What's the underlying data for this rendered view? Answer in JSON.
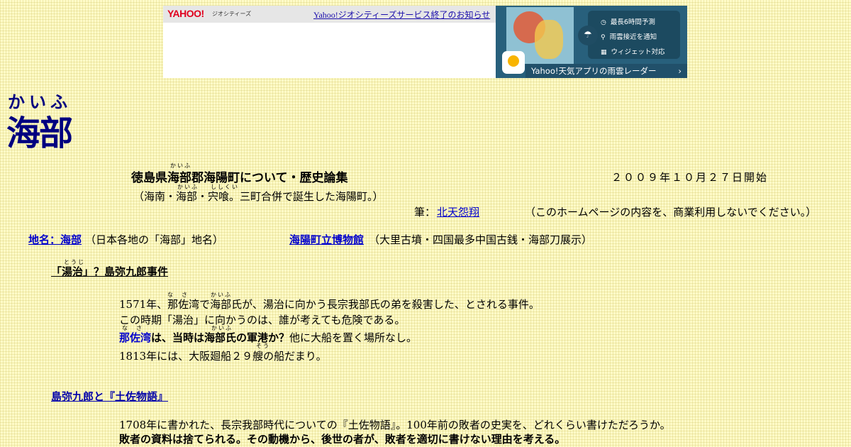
{
  "banner": {
    "logo": "YAHOO!",
    "logo_sub": "ジオシティーズ",
    "notice_link": "Yahoo!ジオシティーズサービス終了のお知らせ"
  },
  "ad": {
    "features": [
      "最長6時間予測",
      "雨雲接近を通知",
      "ウィジェット対応"
    ],
    "bottom": "Yahoo!天気アプリの雨雲レーダー",
    "bottom_arrow": "›",
    "feature_icons": [
      "clock-icon",
      "pin-icon",
      "widget-icon"
    ]
  },
  "header": {
    "title_ruby": "かいふ",
    "title": "海部",
    "subtitle": "徳島県海部郡海陽町について・歴史論集",
    "subtitle_ruby_kaifu": "かいふ",
    "start_date": "２００９年１０月２７日開始",
    "subnote": "（海南・海部・宍喰。三町合併で誕生した海陽町。）",
    "subnote_ruby_kaifu": "かいふ",
    "subnote_ruby_shishikui": "ししくい",
    "author_label": "筆：",
    "author": "北天怨翔",
    "usage_notice": "（このホームページの内容を、商業利用しないでください。）"
  },
  "nav": {
    "link1": "地名：海部",
    "link1_desc": "（日本各地の「海部」地名）",
    "link2": "海陽町立博物館",
    "link2_desc": "（大里古墳・四国最多中国古銭・海部刀展示）"
  },
  "section1": {
    "title": "「湯治」？島弥九郎事件",
    "title_ruby": "とうじ",
    "line1": "1571年、那佐湾で海部氏が、湯治に向かう長宗我部氏の弟を殺害した、とされる事件。",
    "line1_ruby_nasa": "な　さ",
    "line1_ruby_kaifu": "かいふ",
    "line2": "この時期「湯治」に向かうのは、誰が考えても危険である。",
    "line3_link": "那佐湾",
    "line3_bold": "は、当時は海部氏の軍港か？",
    "line3_rest": "他に大船を置く場所なし。",
    "line3_ruby_nasa": "な　さ",
    "line3_ruby_kaifu": "かいふ",
    "line4": "1813年には、大阪廻船２９艘の船だまり。",
    "line4_ruby": "そう"
  },
  "section2": {
    "title": "島弥九郎と『土佐物語』",
    "line1": "1708年に書かれた、長宗我部時代についての『土佐物語』。100年前の敗者の史実を、どれくらい書けただろうか。",
    "line2": "敗者の資料は捨てられる。その動機から、後世の者が、敗者を適切に書けない理由を考える。"
  }
}
